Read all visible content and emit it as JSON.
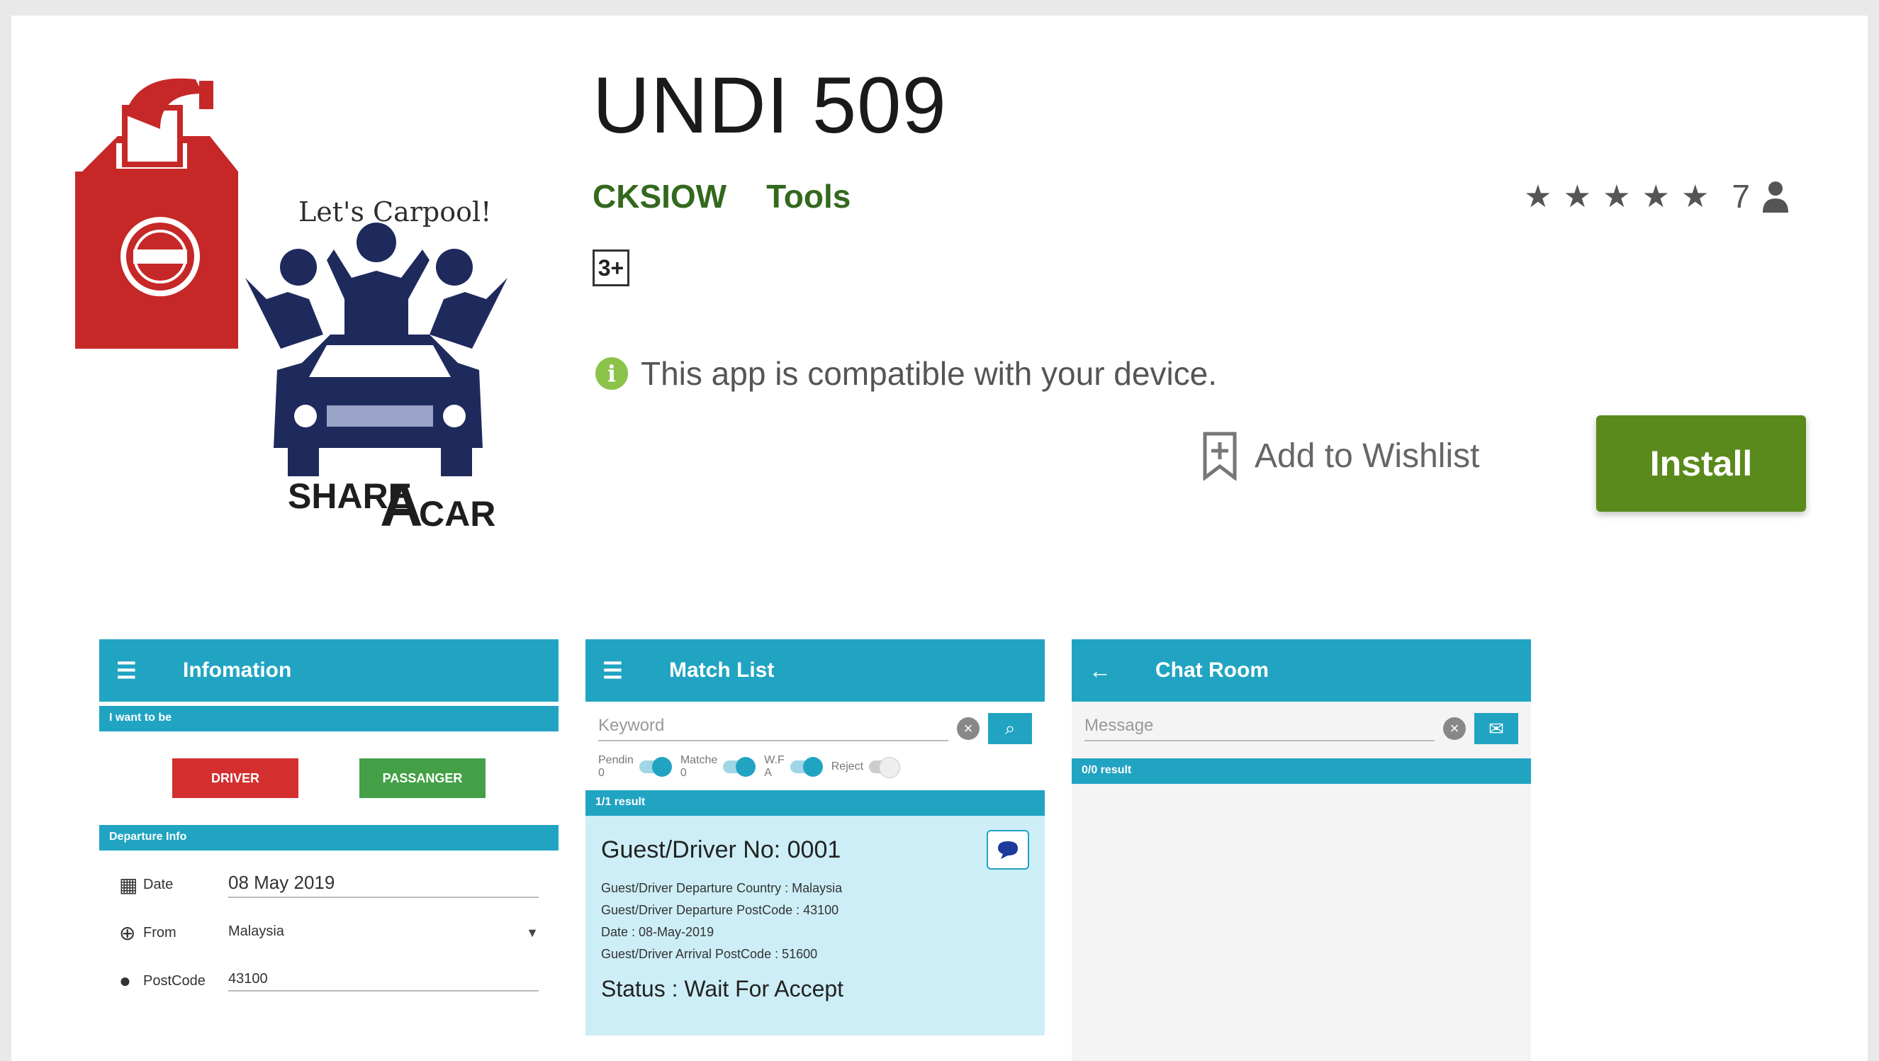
{
  "app": {
    "title": "UNDI 509",
    "developer": "CKSIOW",
    "category": "Tools",
    "content_rating": "3+",
    "rating_stars": "★★★★★",
    "rating_count": "7",
    "compatibility": "This app is compatible with your device.",
    "wishlist_label": "Add to Wishlist",
    "install_label": "Install"
  },
  "logo": {
    "tagline": "Let's Carpool!",
    "share": "SHARE",
    "a": "A",
    "car": "CAR",
    "colors": {
      "box": "#c62828",
      "people": "#1f2a5c"
    }
  },
  "colors": {
    "brand_green": "#33691e",
    "install_bg": "#5a8a1c",
    "appbar": "#21a4c2"
  },
  "screenshots": {
    "info": {
      "title": "Infomation",
      "section1": "I want to be",
      "driver": "DRIVER",
      "passenger": "PASSANGER",
      "section2": "Departure Info",
      "date_label": "Date",
      "date_value": "08 May 2019",
      "from_label": "From",
      "from_value": "Malaysia",
      "postcode_label": "PostCode",
      "postcode_value": "43100"
    },
    "match": {
      "title": "Match List",
      "keyword_placeholder": "Keyword",
      "toggle_pending": "Pendin",
      "toggle_pending_count": "0",
      "toggle_matched": "Matche",
      "toggle_matched_count": "0",
      "toggle_wait": "W.F",
      "toggle_wait_count": "A",
      "toggle_reject": "Reject",
      "result": "1/1 result",
      "card_title": "Guest/Driver No: 0001",
      "line1": "Guest/Driver Departure Country : Malaysia",
      "line2": "Guest/Driver Departure PostCode : 43100",
      "line3": "Date : 08-May-2019",
      "line4": "Guest/Driver Arrival PostCode : 51600",
      "status": "Status : Wait For Accept"
    },
    "chat": {
      "title": "Chat Room",
      "message_placeholder": "Message",
      "result": "0/0 result"
    }
  }
}
